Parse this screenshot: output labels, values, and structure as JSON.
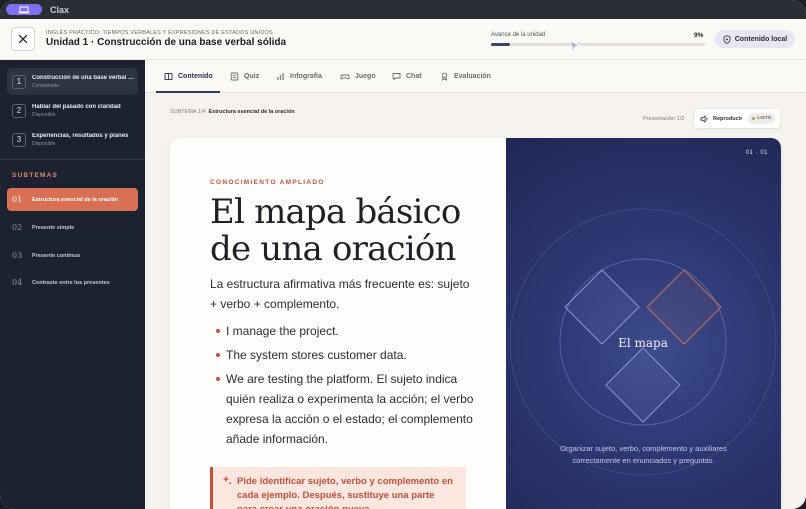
{
  "app": {
    "name": "Clax"
  },
  "header": {
    "crumb": "INGLÉS PRÁCTICO: TIEMPOS VERBALES Y EXPRESIONES DE ESTADOS UNIDOS",
    "title": "Unidad 1 · Construcción de una base verbal sólida",
    "progress_label": "Avance de la unidad",
    "progress_value": "9%",
    "progress_fraction": 0.09,
    "local_button": "Contenido local"
  },
  "sidebar": {
    "lessons": [
      {
        "num": "1",
        "title": "Construcción de una base verbal sólida",
        "status": "Completada"
      },
      {
        "num": "2",
        "title": "Hablar del pasado con claridad",
        "status": "Disponible"
      },
      {
        "num": "3",
        "title": "Experiencias, resultados y planes",
        "status": "Disponible"
      }
    ],
    "subtemas_label": "SUBTEMAS",
    "subtemas": [
      {
        "num": "01",
        "label": "Estructura esencial de la oración"
      },
      {
        "num": "02",
        "label": "Presente simple"
      },
      {
        "num": "03",
        "label": "Presente continuo"
      },
      {
        "num": "04",
        "label": "Contraste entre los presentes"
      }
    ]
  },
  "tabs": [
    {
      "label": "Contenido",
      "icon": "book-icon"
    },
    {
      "label": "Quiz",
      "icon": "quiz-icon"
    },
    {
      "label": "Infografía",
      "icon": "chart-icon"
    },
    {
      "label": "Juego",
      "icon": "gamepad-icon"
    },
    {
      "label": "Chat",
      "icon": "chat-icon"
    },
    {
      "label": "Evaluación",
      "icon": "evaluation-icon"
    }
  ],
  "content": {
    "subtema_prefix": "SUBTEMA 1/4",
    "subtema_title": "Estructura esencial de la oración",
    "presentation": "Presentación 1/2",
    "play": "Reproducir",
    "ready": "LISTO"
  },
  "slide": {
    "eyebrow": "CONOCIMIENTO AMPLIADO",
    "headline": "El mapa básico de una oración",
    "lead": "La estructura afirmativa más frecuente es: sujeto + verbo + complemento.",
    "bullets": [
      "I manage the project.",
      "The system stores customer data.",
      "We are testing the platform. El sujeto indica quién realiza o experimenta la acción; el verbo expresa la acción o el estado; el complemento añade información."
    ],
    "tip": "Pide identificar sujeto, verbo y complemento en cada ejemplo. Después, sustituye una parte para crear una oración nueva.",
    "counter": "01 · 01",
    "center_label": "El mapa",
    "caption": "Organizar sujeto, verbo, complemento y auxiliares correctamente en enunciados y preguntas."
  },
  "colors": {
    "accent": "#c2513a",
    "sidebar_bg": "#1d2230",
    "slide_navy": "#2c3772",
    "active_subtema": "#d96f55"
  }
}
